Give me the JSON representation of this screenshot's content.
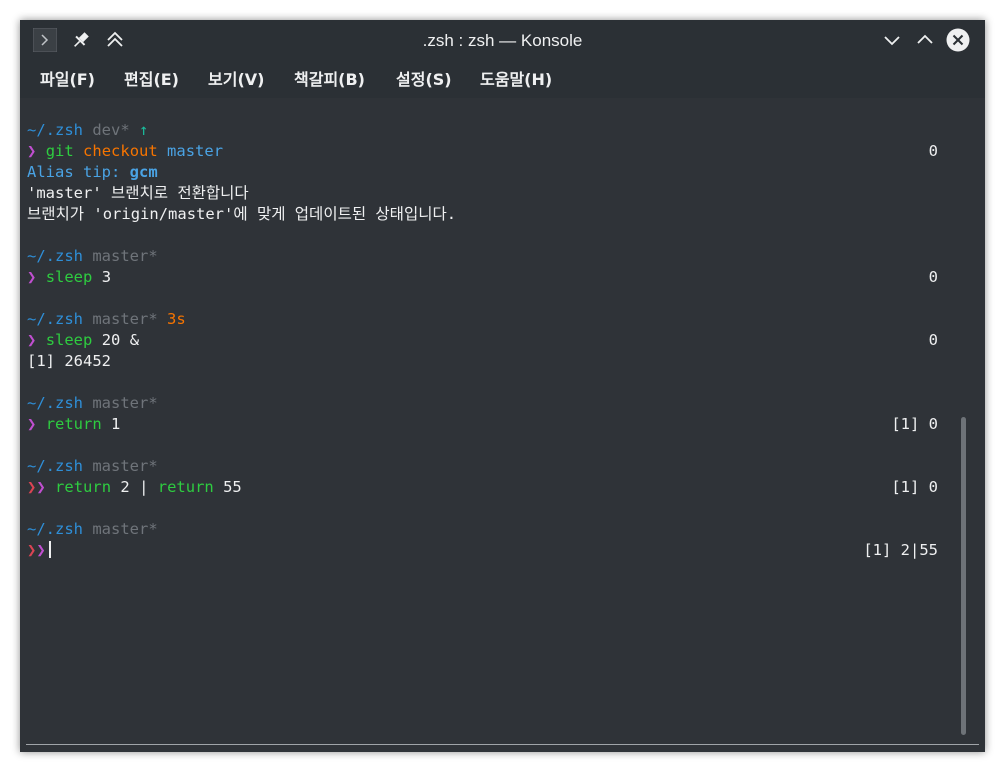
{
  "window": {
    "title": ".zsh : zsh — Konsole",
    "icons": [
      "terminal-app-icon",
      "pin-icon",
      "keep-above-icon",
      "minimize-icon",
      "maximize-icon",
      "close-icon"
    ]
  },
  "menu": [
    {
      "label": "파일(F)"
    },
    {
      "label": "편집(E)"
    },
    {
      "label": "보기(V)"
    },
    {
      "label": "책갈피(B)"
    },
    {
      "label": "설정(S)"
    },
    {
      "label": "도움말(H)"
    }
  ],
  "colors": {
    "background": "#2f3338",
    "path": "#2f8fd8",
    "branch": "#6f747a",
    "command": "#2ecc40",
    "arg_highlight": "#f67400",
    "prompt_ok": "#c04fd0",
    "prompt_err": "#da4453"
  },
  "terminal": {
    "b1": {
      "path": "~/.zsh",
      "branch": "dev*",
      "arrow": "↑",
      "prompt": "❯",
      "cmd": "git",
      "sub": "checkout",
      "arg": "master",
      "rstatus": "0",
      "alias_label": "Alias tip:",
      "alias_value": "gcm",
      "out1": "'master' 브랜치로 전환합니다",
      "out2": "브랜치가 'origin/master'에 맞게 업데이트된 상태입니다."
    },
    "b2": {
      "path": "~/.zsh",
      "branch": "master*",
      "prompt": "❯",
      "cmd": "sleep",
      "arg": "3",
      "rstatus": "0"
    },
    "b3": {
      "path": "~/.zsh",
      "branch": "master*",
      "duration": "3s",
      "prompt": "❯",
      "cmd": "sleep",
      "arg": "20 &",
      "rstatus": "0",
      "out1": "[1] 26452"
    },
    "b4": {
      "path": "~/.zsh",
      "branch": "master*",
      "prompt": "❯",
      "cmd": "return",
      "arg": "1",
      "rstatus": "[1] 0"
    },
    "b5": {
      "path": "~/.zsh",
      "branch": "master*",
      "prompt1": "❯",
      "prompt2": "❯",
      "cmd1": "return",
      "arg1": "2",
      "pipe": "|",
      "cmd2": "return",
      "arg2": "55",
      "rstatus": "[1] 0"
    },
    "b6": {
      "path": "~/.zsh",
      "branch": "master*",
      "prompt1": "❯",
      "prompt2": "❯",
      "rstatus": "[1] 2|55"
    }
  }
}
